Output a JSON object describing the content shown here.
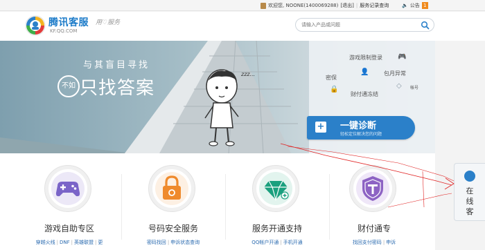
{
  "topbar": {
    "greeting": "欢迎您, NOONE(1400069288)",
    "logout": "[退出]",
    "service_record": "服务记录查询",
    "notice": "公告",
    "notice_count": "1"
  },
  "header": {
    "logo_title": "腾讯客服",
    "logo_domain": "KF.QQ.COM",
    "slogan": "用♡服务",
    "search_placeholder": "请输入产品或问题"
  },
  "banner": {
    "line1": "与其盲目寻找",
    "buru": "不如",
    "line2": "只找答案",
    "zzz": "zzz...",
    "panel_items": [
      "游戏限制登录",
      "密保",
      "包月异常",
      "财付通冻结",
      "帐号"
    ],
    "diagnose_title": "一键诊断",
    "diagnose_sub": "轻松定位解决您的问题"
  },
  "services": [
    {
      "title": "游戏自助专区",
      "links": [
        "穿越火线",
        "DNF",
        "英雄联盟",
        "更"
      ]
    },
    {
      "title": "号码安全服务",
      "links": [
        "密码找回",
        "申诉状态查询"
      ]
    },
    {
      "title": "服务开通支持",
      "links": [
        "QQ帐户开通",
        "手机开通"
      ]
    },
    {
      "title": "财付通专",
      "links": [
        "找回支付密码",
        "申诉"
      ]
    }
  ],
  "float_panel": {
    "label": "在线客"
  },
  "colors": {
    "brand_blue": "#2b80c9",
    "game_purple": "#7a64c8",
    "security_orange": "#ef8a2c",
    "service_green": "#1aa07e",
    "tenpay_purple": "#8d63c4",
    "annotation_red": "#e02020"
  }
}
